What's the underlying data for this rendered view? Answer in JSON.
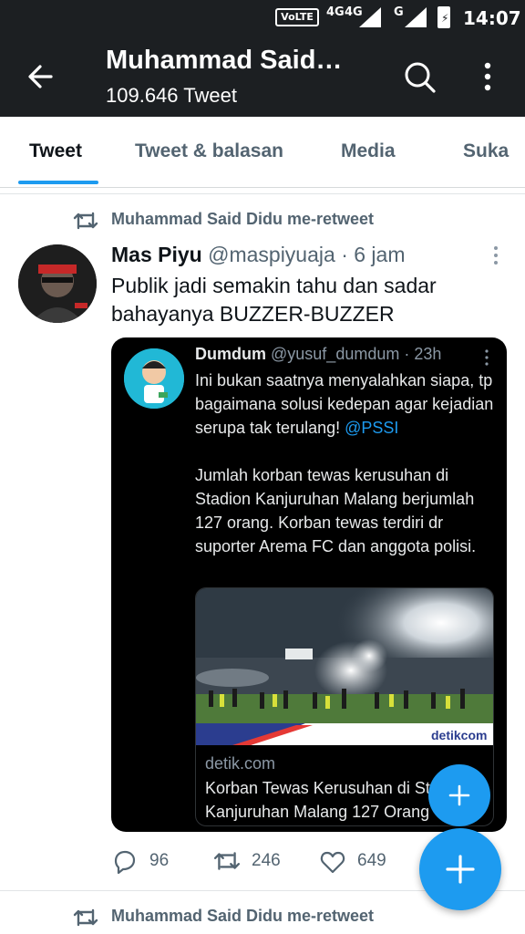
{
  "status_bar": {
    "volte": "VoLTE",
    "net1": "4G",
    "net1_sub": "4G",
    "net2": "4G",
    "net3": "G",
    "time": "14:07"
  },
  "header": {
    "title": "Muhammad Said…",
    "subtitle": "109.646 Tweet",
    "icons": [
      "back-arrow-icon",
      "search-icon",
      "more-vertical-icon"
    ]
  },
  "tabs": [
    {
      "label": "Tweet",
      "active": true
    },
    {
      "label": "Tweet & balasan",
      "active": false
    },
    {
      "label": "Media",
      "active": false
    },
    {
      "label": "Suka",
      "active": false
    }
  ],
  "retweet_label": "Muhammad Said Didu me-retweet",
  "tweet": {
    "name": "Mas Piyu",
    "handle": "@maspiyuaja",
    "time": "· 6 jam",
    "text": "Publik jadi semakin tahu dan sadar bahayanya BUZZER-BUZZER",
    "quote": {
      "name": "Dumdum",
      "handle": "@yusuf_dumdum",
      "time": "· 23h",
      "para1": "Ini bukan saatnya menyalahkan siapa, tp bagaimana solusi kedepan agar kejadian serupa tak terulang! ",
      "mention": "@PSSI",
      "para2": "Jumlah korban tewas kerusuhan di Stadion Kanjuruhan Malang berjumlah 127 orang. Korban tewas terdiri dr suporter Arema FC dan anggota polisi.",
      "link": {
        "domain": "detik.com",
        "title": "Korban Tewas Kerusuhan di Stadion Kanjuruhan Malang 127 Orang",
        "watermark": "detikcom"
      }
    },
    "stats": {
      "replies": "96",
      "retweets": "246",
      "likes": "649"
    }
  },
  "next_retweet_label": "Muhammad Said Didu me-retweet",
  "colors": {
    "accent": "#1d9bf0",
    "header_bg": "#1c1f22",
    "secondary_text": "#536471"
  }
}
